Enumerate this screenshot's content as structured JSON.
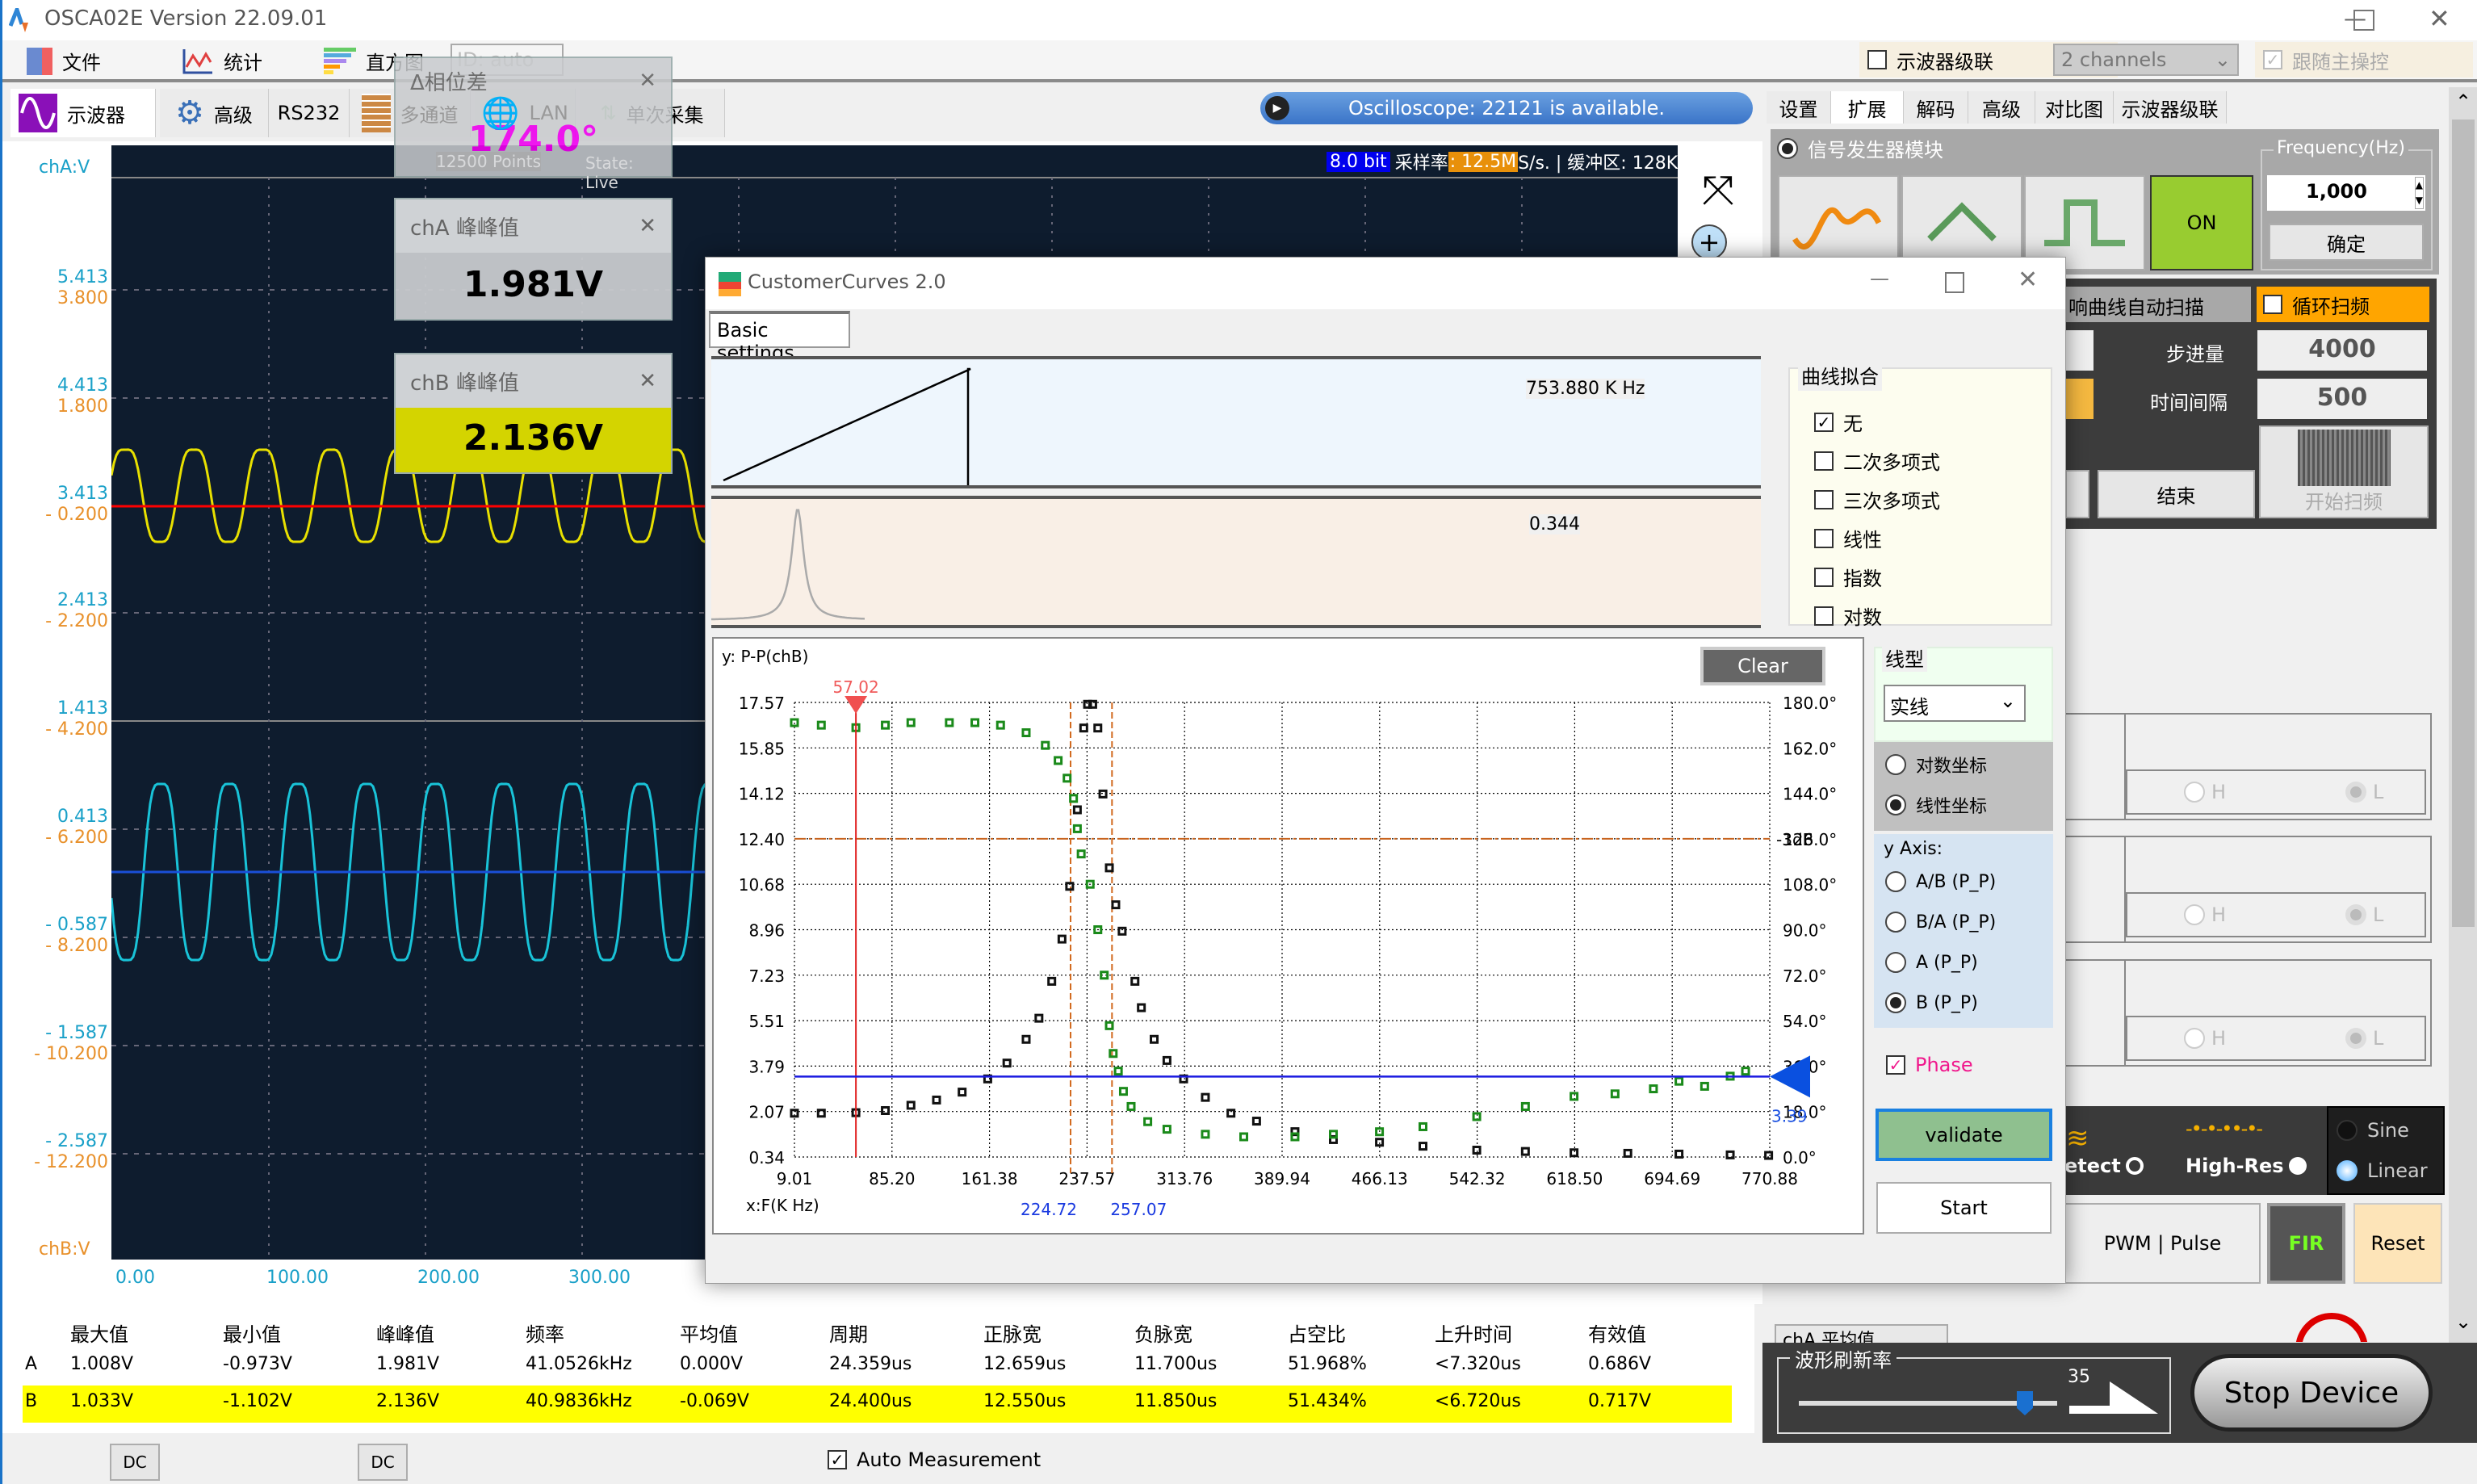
{
  "app": {
    "title": "OSCA02E  Version 22.09.01"
  },
  "menu": {
    "items": [
      "文件",
      "统计",
      "直方图"
    ],
    "id_combo": "ID: auto"
  },
  "cascade": {
    "label": "示波器级联",
    "checked": false,
    "channels": "2 channels",
    "follow_label": "跟随主操控",
    "follow_checked": true
  },
  "main_tabs": [
    "示波器",
    "高级",
    "RS232",
    "多通道",
    "LAN",
    "单次采集"
  ],
  "status": "Oscilloscope: 22121 is available.",
  "scope": {
    "bit": "8.0 bit",
    "rate_label": "采样率",
    "rate": ": 12.5M",
    "rate_tail": " S/s. | 缓冲区: 128K.",
    "cha_unit": "chA:V",
    "chb_unit": "chB:V",
    "cha_ticks": [
      "5.413",
      "4.413",
      "3.413",
      "2.413",
      "1.413",
      "0.413",
      "- 0.587",
      "- 1.587",
      "- 2.587"
    ],
    "chb_ticks": [
      "3.800",
      "1.800",
      "- 0.200",
      "- 2.200",
      "- 4.200",
      "- 6.200",
      "- 8.200",
      "- 10.200",
      "- 12.200"
    ],
    "x_ticks": [
      "0.00",
      "100.00",
      "200.00",
      "300.00"
    ],
    "colors": {
      "cha": "#e8e000",
      "chb": "#19c3d8",
      "cha_level": "#ff0000",
      "chb_level": "#1a4fd8",
      "bg": "#0e1c2e"
    }
  },
  "phase_popup": {
    "title": "Δ相位差",
    "value": "174.0°",
    "points": "12500 Points",
    "state": "State: Live"
  },
  "cha_pp": {
    "title": "chA 峰峰值",
    "value": "1.981V"
  },
  "chb_pp": {
    "title": "chB 峰峰值",
    "value": "2.136V"
  },
  "measurements": {
    "headers": [
      "最大值",
      "最小值",
      "峰峰值",
      "频率",
      "平均值",
      "周期",
      "正脉宽",
      "负脉宽",
      "占空比",
      "上升时间",
      "有效值"
    ],
    "rows": [
      {
        "ch": "A",
        "values": [
          "1.008V",
          "-0.973V",
          "1.981V",
          "41.0526kHz",
          "0.000V",
          "24.359us",
          "12.659us",
          "11.700us",
          "51.968%",
          "<7.320us",
          "0.686V"
        ]
      },
      {
        "ch": "B",
        "values": [
          "1.033V",
          "-1.102V",
          "2.136V",
          "40.9836kHz",
          "-0.069V",
          "24.400us",
          "12.550us",
          "11.850us",
          "51.434%",
          "<6.720us",
          "0.717V"
        ]
      }
    ]
  },
  "bottom": {
    "dc_a": "DC",
    "dc_b": "DC",
    "auto_label": "Auto Measurement",
    "auto_checked": true
  },
  "right_panel": {
    "tabs": [
      "设置",
      "扩展",
      "解码",
      "高级",
      "对比图",
      "示波器级联"
    ],
    "active_tab": "扩展",
    "siggen": {
      "title": "信号发生器模块",
      "on": "ON",
      "freq_label": "Frequency(Hz)",
      "freq": "1,000",
      "confirm": "确定"
    },
    "sweep": {
      "title": "响曲线自动扫描",
      "loop": "循环扫频",
      "loop_checked": false,
      "step_label": "步进量",
      "step": "4000",
      "interval_label": "时间间隔",
      "interval": "500",
      "end": "结束",
      "start": "开始扫频"
    },
    "hl": {
      "h": "H",
      "l": "L"
    },
    "modes": {
      "detect": "etect",
      "highres": "High-Res",
      "sine": "Sine",
      "linear": "Linear"
    },
    "pwm": "PWM | Pulse",
    "fir": "FIR",
    "reset": "Reset",
    "avg_combo": "chA 平均值",
    "refresh": {
      "label": "波形刷新率",
      "value": 35,
      "max": 40
    },
    "stop": "Stop Device"
  },
  "dialog": {
    "title": "CustomerCurves 2.0",
    "tab": "Basic settings",
    "freq_readout": "753.880 K Hz",
    "amp_readout": "0.344",
    "fit": {
      "title": "曲线拟合",
      "options": [
        {
          "label": "无",
          "checked": true
        },
        {
          "label": "二次多项式",
          "checked": false
        },
        {
          "label": "三次多项式",
          "checked": false
        },
        {
          "label": "线性",
          "checked": false
        },
        {
          "label": "指数",
          "checked": false
        },
        {
          "label": "对数",
          "checked": false
        }
      ]
    },
    "line_type": {
      "title": "线型",
      "value": "实线"
    },
    "coord": {
      "options": [
        "对数坐标",
        "线性坐标"
      ],
      "selected": 1
    },
    "yaxis": {
      "title": "y Axis:",
      "options": [
        "A/B (P_P)",
        "B/A (P_P)",
        "A (P_P)",
        "B (P_P)"
      ],
      "selected": 3
    },
    "phase": {
      "label": "Phase",
      "checked": true
    },
    "validate": "validate",
    "start": "Start",
    "clear": "Clear"
  },
  "chart_data": {
    "type": "scatter",
    "ylabel": "y: P-P(chB)",
    "xlabel": "x:F(K Hz)",
    "xlim": [
      9.01,
      770.88
    ],
    "ylim": [
      0.34,
      17.57
    ],
    "y2lim": [
      0,
      180
    ],
    "grid": true,
    "x_ticks": [
      "9.01",
      "85.20",
      "161.38",
      "237.57",
      "313.76",
      "389.94",
      "466.13",
      "542.32",
      "618.50",
      "694.69",
      "770.88"
    ],
    "y_ticks": [
      "17.57",
      "15.85",
      "14.12",
      "12.40",
      "10.68",
      "8.96",
      "7.23",
      "5.51",
      "3.79",
      "2.07",
      "0.34"
    ],
    "y2_ticks": [
      "180.0°",
      "162.0°",
      "144.0°",
      "126.0°",
      "108.0°",
      "90.0°",
      "72.0°",
      "54.0°",
      "36.0°",
      "18.0°",
      "0.0°"
    ],
    "cursor": {
      "x": 57.02,
      "label": "57.02"
    },
    "band": {
      "x": [
        224.72,
        257.07
      ],
      "labels": [
        "224.72",
        "257.07"
      ]
    },
    "minus3db": {
      "y": 12.4,
      "label": "-3dB"
    },
    "level": {
      "y": 3.39,
      "label": "3.39"
    },
    "series": [
      {
        "axis": "left",
        "color": "#111111",
        "points": [
          [
            9,
            2.0
          ],
          [
            30,
            2.0
          ],
          [
            57,
            2.02
          ],
          [
            80,
            2.1
          ],
          [
            100,
            2.3
          ],
          [
            120,
            2.5
          ],
          [
            140,
            2.8
          ],
          [
            160,
            3.3
          ],
          [
            175,
            3.9
          ],
          [
            190,
            4.8
          ],
          [
            200,
            5.6
          ],
          [
            210,
            7.0
          ],
          [
            218,
            8.6
          ],
          [
            224,
            10.6
          ],
          [
            230,
            13.5
          ],
          [
            235,
            16.6
          ],
          [
            238,
            17.5
          ],
          [
            242,
            17.5
          ],
          [
            246,
            16.6
          ],
          [
            250,
            14.1
          ],
          [
            255,
            11.3
          ],
          [
            260,
            9.9
          ],
          [
            265,
            8.9
          ],
          [
            275,
            7.0
          ],
          [
            280,
            6.0
          ],
          [
            290,
            4.8
          ],
          [
            300,
            4.0
          ],
          [
            313,
            3.3
          ],
          [
            330,
            2.6
          ],
          [
            350,
            2.0
          ],
          [
            370,
            1.7
          ],
          [
            400,
            1.3
          ],
          [
            430,
            1.0
          ],
          [
            466,
            0.9
          ],
          [
            500,
            0.75
          ],
          [
            542,
            0.6
          ],
          [
            580,
            0.55
          ],
          [
            618,
            0.5
          ],
          [
            660,
            0.48
          ],
          [
            700,
            0.45
          ],
          [
            740,
            0.42
          ],
          [
            770,
            0.4
          ]
        ]
      },
      {
        "axis": "right",
        "color": "#1a8a1a",
        "points": [
          [
            9,
            172
          ],
          [
            30,
            171
          ],
          [
            57,
            170
          ],
          [
            80,
            171
          ],
          [
            100,
            172
          ],
          [
            130,
            172
          ],
          [
            150,
            172
          ],
          [
            170,
            171
          ],
          [
            190,
            168
          ],
          [
            205,
            163
          ],
          [
            215,
            157
          ],
          [
            222,
            150
          ],
          [
            227,
            142
          ],
          [
            230,
            130
          ],
          [
            233,
            120
          ],
          [
            240,
            108
          ],
          [
            246,
            90
          ],
          [
            251,
            72
          ],
          [
            255,
            52
          ],
          [
            258,
            41
          ],
          [
            262,
            34
          ],
          [
            266,
            26
          ],
          [
            272,
            20
          ],
          [
            285,
            14
          ],
          [
            300,
            11
          ],
          [
            330,
            9
          ],
          [
            360,
            8
          ],
          [
            400,
            8
          ],
          [
            430,
            9
          ],
          [
            466,
            10
          ],
          [
            500,
            12
          ],
          [
            542,
            16
          ],
          [
            580,
            20
          ],
          [
            618,
            24
          ],
          [
            650,
            25
          ],
          [
            680,
            27
          ],
          [
            700,
            30
          ],
          [
            720,
            28
          ],
          [
            740,
            32
          ],
          [
            752,
            34
          ]
        ]
      }
    ]
  }
}
